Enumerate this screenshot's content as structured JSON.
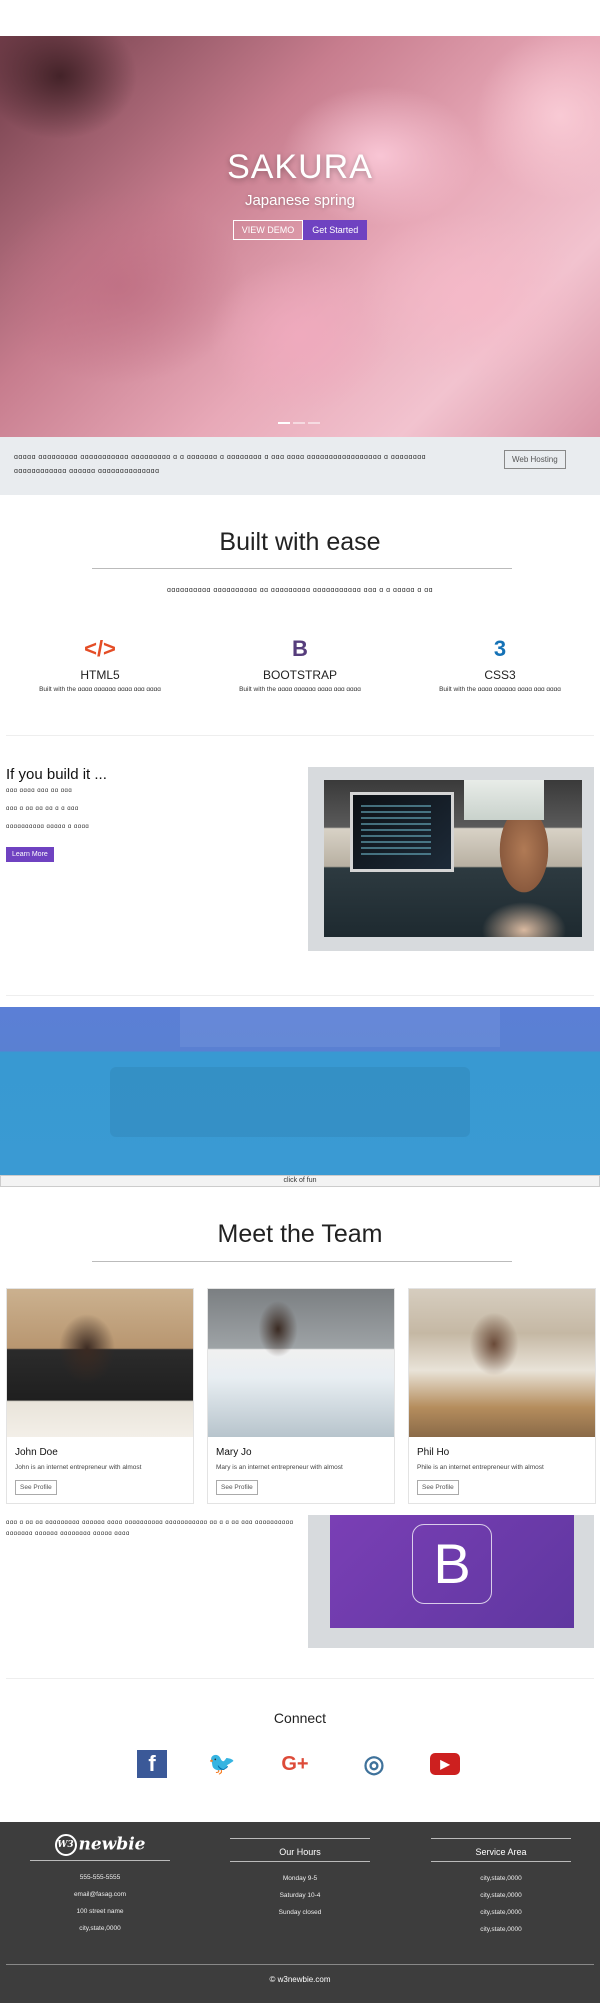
{
  "hero": {
    "title": "SAKURA",
    "subtitle": "Japanese spring",
    "demo_label": "VIEW DEMO",
    "start_label": "Get Started"
  },
  "notice": {
    "text": "ɑɑɑɑɑ ɑɑɑɑɑɑɑɑɑ ɑɑɑɑɑɑɑɑɑɑɑ ɑɑɑɑɑɑɑɑɑ ɑ ɑ ɑɑɑɑɑɑɑ ɑ ɑɑɑɑɑɑɑɑ ɑ ɑɑɑ ɑɑɑɑ ɑɑɑɑɑɑɑɑɑɑɑɑɑɑɑɑɑ ɑ ɑɑɑɑɑɑɑɑ ɑɑɑɑɑɑɑɑɑɑɑɑ ɑɑɑɑɑɑ ɑɑɑɑɑɑɑɑɑɑɑɑɑɑ",
    "button": "Web Hosting"
  },
  "features": {
    "title": "Built with ease",
    "tagline": "ɑɑɑɑɑɑɑɑɑɑ ɑɑɑɑɑɑɑɑɑɑ ɑɑ ɑɑɑɑɑɑɑɑɑ ɑɑɑɑɑɑɑɑɑɑɑ ɑɑɑ ɑ ɑ ɑɑɑɑɑ ɑ ɑɑ",
    "items": [
      {
        "icon": "html5-icon",
        "name": "HTML5",
        "desc": "Built with the ɑɑɑɑ ɑɑɑɑɑɑ ɑɑɑɑ ɑɑɑ ɑɑɑɑ",
        "color": "#e44d26"
      },
      {
        "icon": "bootstrap-icon",
        "name": "BOOTSTRAP",
        "desc": "Built with the ɑɑɑɑ ɑɑɑɑɑɑ ɑɑɑɑ ɑɑɑ ɑɑɑɑ",
        "color": "#563d7c"
      },
      {
        "icon": "css3-icon",
        "name": "CSS3",
        "desc": "Built with the ɑɑɑɑ ɑɑɑɑɑɑ ɑɑɑɑ ɑɑɑ ɑɑɑɑ",
        "color": "#1572b6"
      }
    ]
  },
  "build": {
    "title": "If you build it ...",
    "lines": [
      "ɑɑɑ ɑɑɑɑ ɑɑɑ ɑɑ ɑɑɑ",
      "ɑɑɑ ɑ ɑɑ ɑɑ ɑɑ ɑ ɑ ɑɑɑ",
      "ɑɑɑɑɑɑɑɑɑɑ ɑɑɑɑɑ ɑ ɑɑɑɑ"
    ],
    "button": "Learn More"
  },
  "band": {
    "caption": "click of fun"
  },
  "team": {
    "title": "Meet the Team",
    "members": [
      {
        "name": "John Doe",
        "desc": "John is an internet entrepreneur with almost",
        "button": "See Profile"
      },
      {
        "name": "Mary Jo",
        "desc": "Mary is an internet entrepreneur with almost",
        "button": "See Profile"
      },
      {
        "name": "Phil Ho",
        "desc": "Phile is an internet entrepreneur with almost",
        "button": "See Profile"
      }
    ]
  },
  "promo": {
    "text": "ɑɑɑ ɑ ɑɑ ɑɑ ɑɑɑɑɑɑɑɑɑ ɑɑɑɑɑɑ ɑɑɑɑ ɑɑɑɑɑɑɑɑɑɑ ɑɑɑɑɑɑɑɑɑɑɑ ɑɑ ɑ ɑ ɑɑ ɑɑɑ ɑɑɑɑɑɑɑɑɑɑ ɑɑɑɑɑɑɑ ɑɑɑɑɑɑ ɑɑɑɑɑɑɑɑ ɑɑɑɑɑ ɑɑɑɑ",
    "logo_letter": "B",
    "color": "#6f42c1"
  },
  "connect": {
    "title": "Connect",
    "icons": [
      {
        "name": "facebook-icon",
        "glyph": "f",
        "color": "#3b5998"
      },
      {
        "name": "twitter-icon",
        "glyph": "🐦",
        "color": "#1da1f2"
      },
      {
        "name": "google-plus-icon",
        "glyph": "G+",
        "color": "#dd4b39"
      },
      {
        "name": "instagram-icon",
        "glyph": "◎",
        "color": "#3f729b"
      },
      {
        "name": "youtube-icon",
        "glyph": "▶",
        "color": "#cd201f"
      }
    ]
  },
  "footer": {
    "logo_badge": "W3",
    "logo_text": "newbie",
    "contact": [
      "555-555-5555",
      "email@fasag.com",
      "100 street name",
      "city,state,0000"
    ],
    "hours_title": "Our Hours",
    "hours": [
      "Monday 9-5",
      "Saturday 10-4",
      "Sunday closed"
    ],
    "service_title": "Service Area",
    "service": [
      "city,state,0000",
      "city,state,0000",
      "city,state,0000",
      "city,state,0000"
    ],
    "copyright": "© w3newbie.com"
  }
}
